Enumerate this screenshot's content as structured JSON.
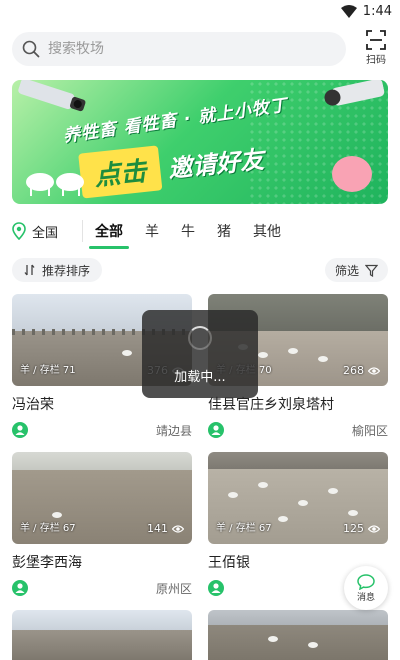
{
  "status": {
    "time": "1:44"
  },
  "search": {
    "placeholder": "搜索牧场",
    "scan_label": "扫码"
  },
  "banner": {
    "line1": "养牲畜 看牲畜 · 就上小牧丁",
    "cta_click": "点击",
    "cta_invite": "邀请好友"
  },
  "filter": {
    "region": "全国",
    "tabs": [
      {
        "label": "全部",
        "active": true
      },
      {
        "label": "羊"
      },
      {
        "label": "牛"
      },
      {
        "label": "猪"
      },
      {
        "label": "其他"
      }
    ]
  },
  "sort": {
    "label": "推荐排序",
    "filter_label": "筛选"
  },
  "cards": [
    {
      "title": "冯治荣",
      "place": "靖边县",
      "tag": "羊 / 存栏 71",
      "views": "376"
    },
    {
      "title": "佳县官庄乡刘泉塔村",
      "place": "榆阳区",
      "tag": "羊 / 存栏 70",
      "views": "268"
    },
    {
      "title": "彭堡李西海",
      "place": "原州区",
      "tag": "羊 / 存栏 67",
      "views": "141"
    },
    {
      "title": "王佰银",
      "place": "",
      "tag": "羊 / 存栏 67",
      "views": "125"
    }
  ],
  "loading": {
    "text": "加载中..."
  },
  "float_button": {
    "label": "消息"
  },
  "colors": {
    "accent": "#27c26a",
    "banner_green": "#3fcf6d"
  }
}
